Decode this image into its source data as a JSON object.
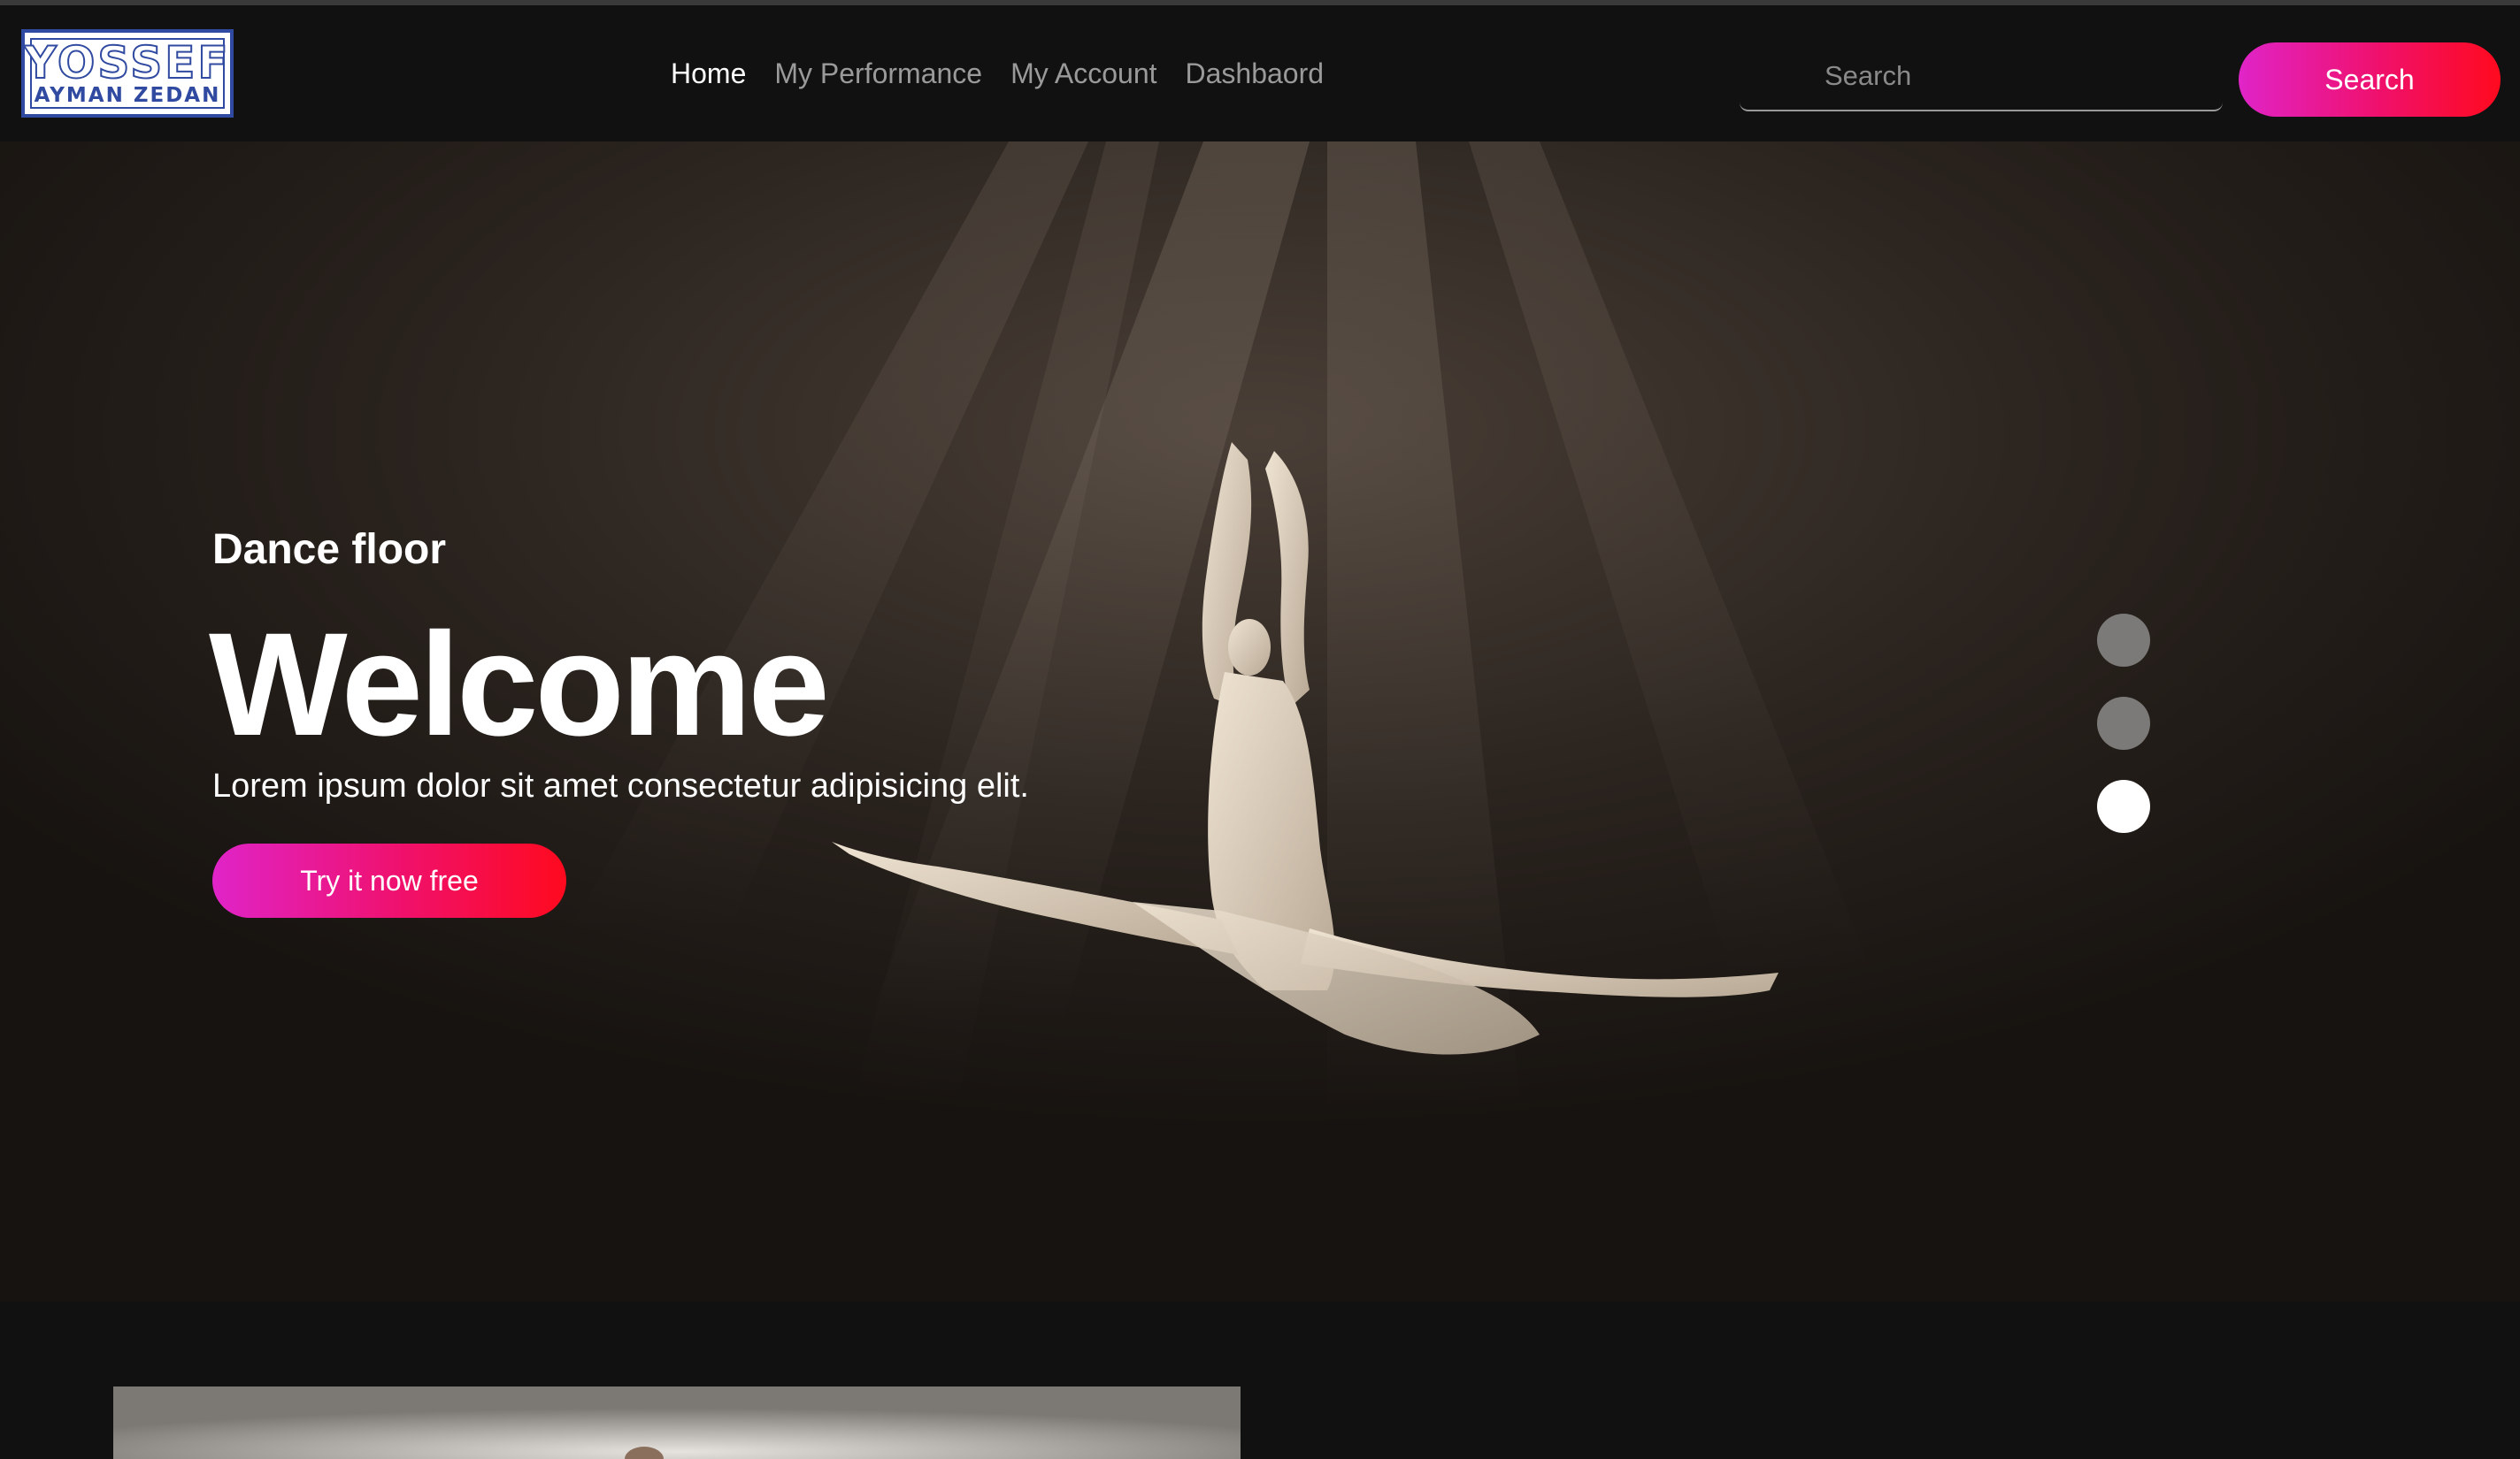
{
  "logo": {
    "line1": "YOSSEF",
    "line2": "AYMAN ZEDAN",
    "color": "#2f4aa0"
  },
  "nav": {
    "links": [
      "Home",
      "My Performance",
      "My Account",
      "Dashbaord"
    ],
    "active": "Home"
  },
  "search": {
    "placeholder": "Search",
    "value": "",
    "button_label": "Search"
  },
  "hero": {
    "subtitle": "Dance floor",
    "title": "Welcome",
    "description": "Lorem ipsum dolor sit amet consectetur adipisicing elit.",
    "cta_label": "Try it now free",
    "slides_count": 3,
    "active_slide": 3
  },
  "colors": {
    "background": "#111111",
    "accent_gradient_start": "#e024c8",
    "accent_gradient_end": "#ff0a1e",
    "hero_tint": "#1d1815"
  }
}
